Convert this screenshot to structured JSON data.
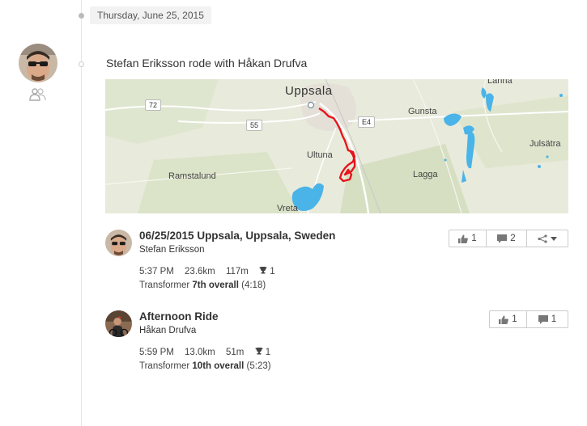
{
  "timeline": {
    "date": "Thursday, June 25, 2015"
  },
  "feed_entry": {
    "headline": "Stefan Eriksson rode with Håkan Drufva"
  },
  "map": {
    "labels": {
      "uppsala": "Uppsala",
      "gunsta": "Gunsta",
      "ultuna": "Ultuna",
      "ramstalund": "Ramstalund",
      "lagga": "Lagga",
      "vreta": "Vreta",
      "julsatra": "Julsätra",
      "lanna": "Lanna"
    },
    "roads": {
      "r72": "72",
      "r55": "55",
      "e4": "E4"
    },
    "route_color": "#e8141b",
    "water_color": "#4ab3e8"
  },
  "activities": [
    {
      "title": "06/25/2015 Uppsala, Uppsala, Sweden",
      "athlete": "Stefan Eriksson",
      "time": "5:37 PM",
      "distance": "23.6km",
      "elevation": "117m",
      "trophies": "1",
      "segment_prefix": "Transformer",
      "segment_rank": "7th overall",
      "segment_time": "(4:18)",
      "kudos": "1",
      "comments": "2",
      "share_icon": "share-icon"
    },
    {
      "title": "Afternoon Ride",
      "athlete": "Håkan Drufva",
      "time": "5:59 PM",
      "distance": "13.0km",
      "elevation": "51m",
      "trophies": "1",
      "segment_prefix": "Transformer",
      "segment_rank": "10th overall",
      "segment_time": "(5:23)",
      "kudos": "1",
      "comments": "1"
    }
  ]
}
